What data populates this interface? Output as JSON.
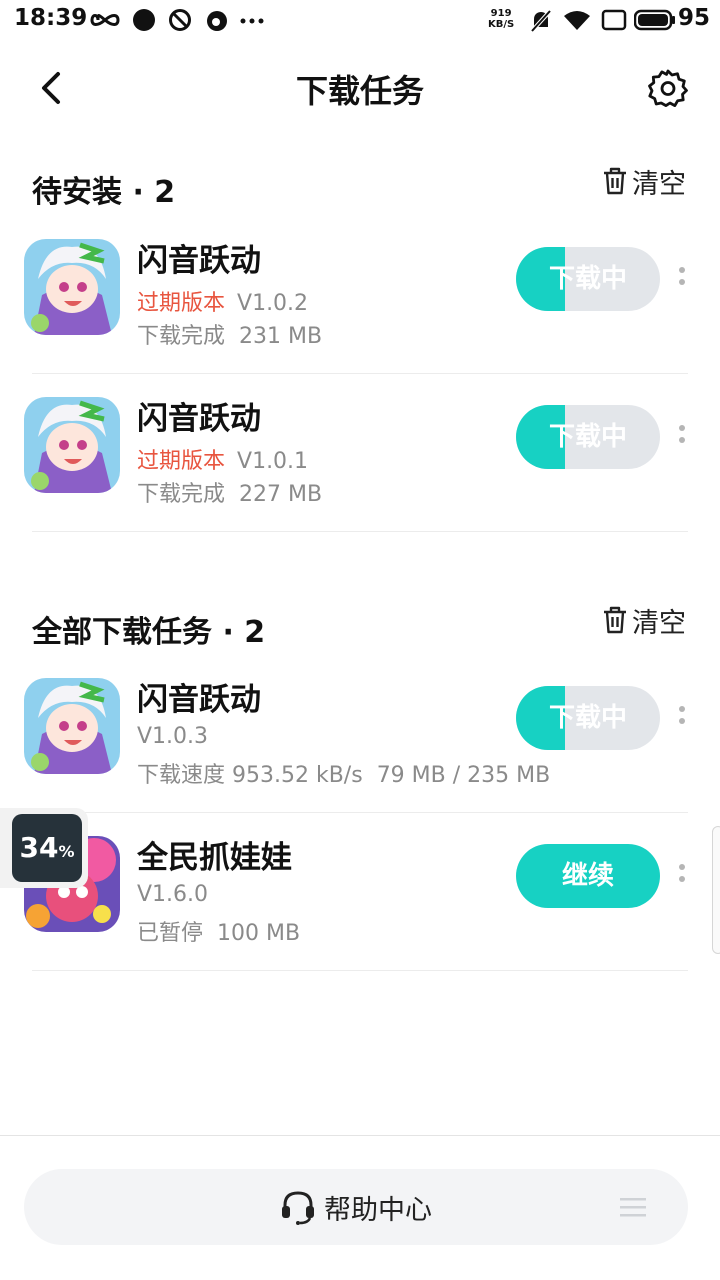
{
  "status_bar": {
    "time": "18:39",
    "speed_value": "919",
    "speed_unit": "KB/S",
    "battery": "95",
    "icons": [
      "infinity-icon",
      "circle-icon",
      "no-disturb-icon",
      "weibo-icon",
      "more-dots-icon",
      "mute-icon",
      "wifi-icon",
      "screen-icon",
      "battery-icon"
    ]
  },
  "header": {
    "title": "下载任务",
    "back_icon": "chevron-left-icon",
    "settings_icon": "gear-icon"
  },
  "pending": {
    "title": "待安装 · 2",
    "clear_label": "清空",
    "items": [
      {
        "name": "闪音跃动",
        "tag": "过期版本",
        "version": "V1.0.2",
        "status": "下载完成",
        "size": "231 MB",
        "button": "下载中",
        "progress": 0.34
      },
      {
        "name": "闪音跃动",
        "tag": "过期版本",
        "version": "V1.0.1",
        "status": "下载完成",
        "size": "227 MB",
        "button": "下载中",
        "progress": 0.34
      }
    ]
  },
  "all": {
    "title": "全部下载任务 · 2",
    "clear_label": "清空",
    "items": [
      {
        "name": "闪音跃动",
        "version": "V1.0.3",
        "speed": "下载速度 953.52 kB/s",
        "progress_text": "79 MB / 235 MB",
        "button": "下载中",
        "progress": 0.34
      },
      {
        "name": "全民抓娃娃",
        "version": "V1.6.0",
        "status": "已暂停",
        "size": "100 MB",
        "button": "继续"
      }
    ]
  },
  "float_badge": {
    "value": "34",
    "unit": "%"
  },
  "bottom": {
    "help_label": "帮助中心"
  },
  "colors": {
    "accent": "#17d1c3",
    "expired": "#e8553f",
    "button_bg": "#e3e6ea",
    "muted_text": "#8a8a8a"
  }
}
